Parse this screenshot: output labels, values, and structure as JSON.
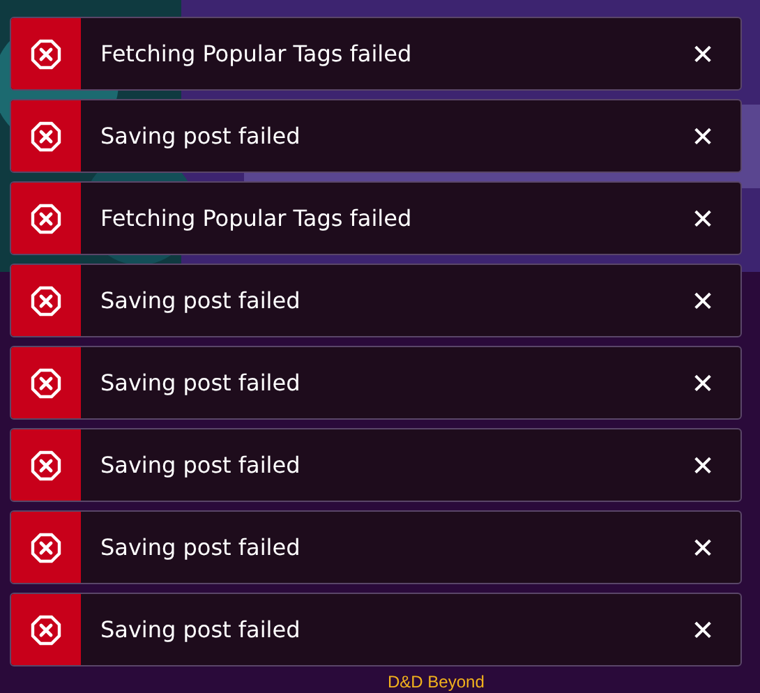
{
  "background": {
    "link": "D&D Beyond"
  },
  "toasts": [
    {
      "kind": "error",
      "message": "Fetching Popular Tags failed",
      "close": "✕"
    },
    {
      "kind": "error",
      "message": "Saving post failed",
      "close": "✕"
    },
    {
      "kind": "error",
      "message": "Fetching Popular Tags failed",
      "close": "✕"
    },
    {
      "kind": "error",
      "message": "Saving post failed",
      "close": "✕"
    },
    {
      "kind": "error",
      "message": "Saving post failed",
      "close": "✕"
    },
    {
      "kind": "error",
      "message": "Saving post failed",
      "close": "✕"
    },
    {
      "kind": "error",
      "message": "Saving post failed",
      "close": "✕"
    },
    {
      "kind": "error",
      "message": "Saving post failed",
      "close": "✕"
    }
  ]
}
